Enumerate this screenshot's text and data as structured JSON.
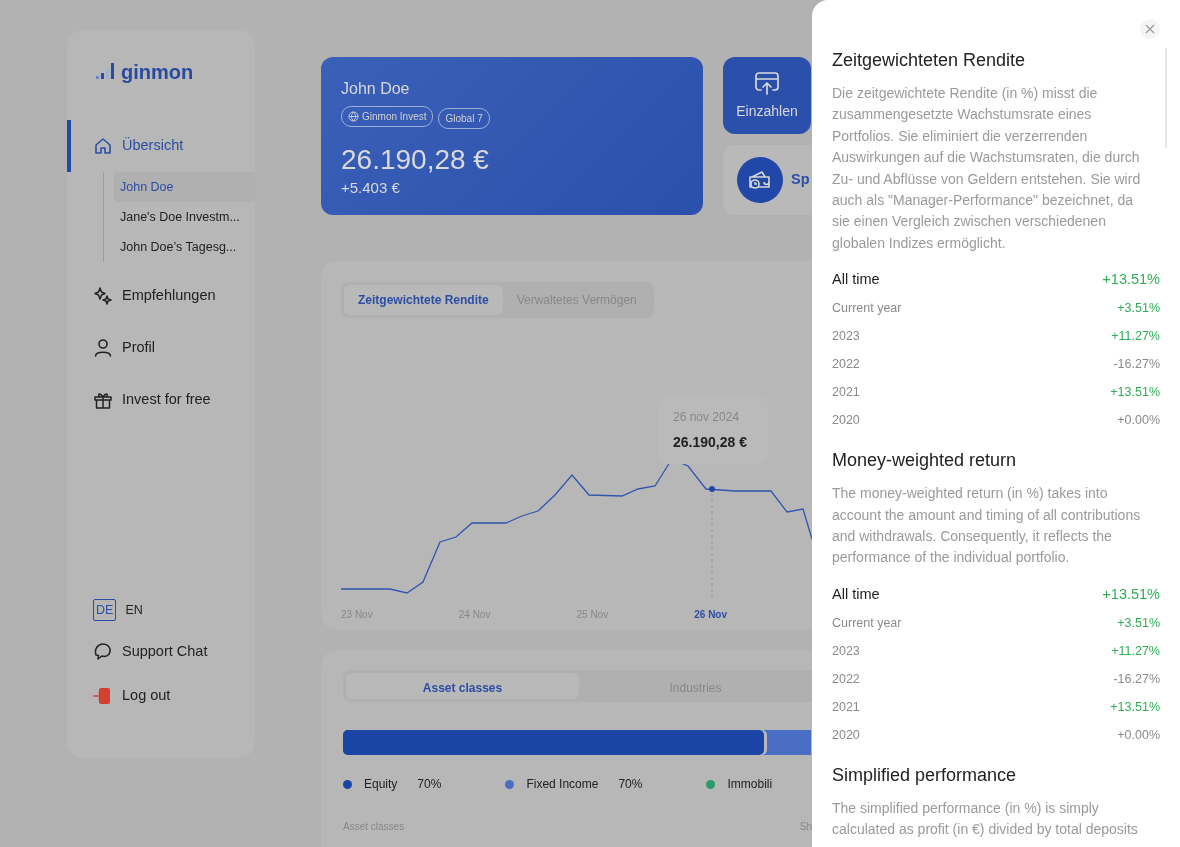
{
  "sidebar": {
    "logo": "ginmon",
    "nav": [
      {
        "label": "Übersicht",
        "selected": true,
        "children": [
          {
            "label": "John Doe",
            "selected": true
          },
          {
            "label": "Jane's Doe Investm...",
            "selected": false
          },
          {
            "label": "John Doe’s Tagesg...",
            "selected": false
          }
        ]
      },
      {
        "label": "Empfehlungen",
        "selected": false
      },
      {
        "label": "Profil",
        "selected": false
      },
      {
        "label": "Invest for free",
        "selected": false
      }
    ],
    "languages": [
      {
        "label": "DE",
        "selected": true
      },
      {
        "label": "EN",
        "selected": false
      }
    ],
    "footer": [
      {
        "label": "Support Chat"
      },
      {
        "label": "Log out"
      }
    ]
  },
  "account_card": {
    "name": "John Doe",
    "badges": [
      {
        "label": "Ginmon Invest",
        "kind": "platform"
      },
      {
        "label": "Global 7",
        "kind": "strategy"
      }
    ],
    "balance": "26.190,28 €",
    "gain": "+5.403 €"
  },
  "actions": [
    {
      "kind": "tile",
      "label": "Einzahlen"
    },
    {
      "kind": "row",
      "label": "Sp"
    }
  ],
  "performance": {
    "tabs": [
      {
        "label": "Zeitgewichtete Rendite",
        "selected": true
      },
      {
        "label": "Verwaltetes Vermögen",
        "selected": false
      }
    ],
    "tooltip": {
      "date": "26 nov 2024",
      "value": "26.190,28 €"
    },
    "x_labels": [
      {
        "label": "23 Nov",
        "selected": false
      },
      {
        "label": "24 Nov",
        "selected": false
      },
      {
        "label": "25 Nov",
        "selected": false
      },
      {
        "label": "26 Nov",
        "selected": true
      }
    ]
  },
  "allocation": {
    "tabs": [
      {
        "label": "Asset classes",
        "selected": true
      },
      {
        "label": "Industries",
        "selected": false
      }
    ],
    "bar": {
      "level": 0.9,
      "segments": [
        {
          "color": "#1a44a6"
        },
        {
          "color": "#4a6ec4"
        }
      ]
    },
    "legend": [
      {
        "label": "Equity",
        "value": "70%",
        "color": "#1a44a6"
      },
      {
        "label": "Fixed Income",
        "value": "70%",
        "color": "#4a6ec4"
      },
      {
        "label": "Immobili",
        "color": "#2a9a6a"
      }
    ],
    "columns": [
      "Asset classes",
      "Sh"
    ]
  },
  "drawer": {
    "sections": [
      {
        "title": "Zeitgewichteten Rendite",
        "text": "Die zeitgewichtete Rendite (in %) misst die zusammengesetzte Wachstumsrate eines Portfolios. Sie eliminiert die verzerrenden Auswirkungen auf die Wachstumsraten, die durch Zu- und Abflüsse von Geldern entstehen. Sie wird auch als \"Manager-Performance\" bezeichnet, da sie einen Vergleich zwischen verschiedenen globalen Indizes ermöglicht.",
        "rows": [
          {
            "kind": "total",
            "label": "All time",
            "value": "+13.51%",
            "color": "#2fae54"
          },
          {
            "kind": "year",
            "label": "Current year",
            "value": "+3.51%",
            "color": "#2fae54"
          },
          {
            "kind": "year",
            "label": "2023",
            "value": "+11.27%",
            "color": "#2fae54"
          },
          {
            "kind": "year",
            "label": "2022",
            "value": "-16.27%",
            "color": "#8a8a8a"
          },
          {
            "kind": "year",
            "label": "2021",
            "value": "+13.51%",
            "color": "#2fae54"
          },
          {
            "kind": "year",
            "label": "2020",
            "value": "+0.00%",
            "color": "#8a8a8a"
          }
        ]
      },
      {
        "title": "Money-weighted return",
        "text": "The money-weighted return (in %) takes into account the amount and timing of all contributions and withdrawals. Consequently, it reflects the performance of the individual portfolio.",
        "rows": [
          {
            "kind": "total",
            "label": "All time",
            "value": "+13.51%",
            "color": "#2fae54"
          },
          {
            "kind": "year",
            "label": "Current year",
            "value": "+3.51%",
            "color": "#2fae54"
          },
          {
            "kind": "year",
            "label": "2023",
            "value": "+11.27%",
            "color": "#2fae54"
          },
          {
            "kind": "year",
            "label": "2022",
            "value": "-16.27%",
            "color": "#8a8a8a"
          },
          {
            "kind": "year",
            "label": "2021",
            "value": "+13.51%",
            "color": "#2fae54"
          },
          {
            "kind": "year",
            "label": "2020",
            "value": "+0.00%",
            "color": "#8a8a8a"
          }
        ]
      },
      {
        "title": "Simplified performance",
        "text": "The simplified performance (in %) is simply calculated as profit (in €) divided by total deposits"
      }
    ]
  }
}
